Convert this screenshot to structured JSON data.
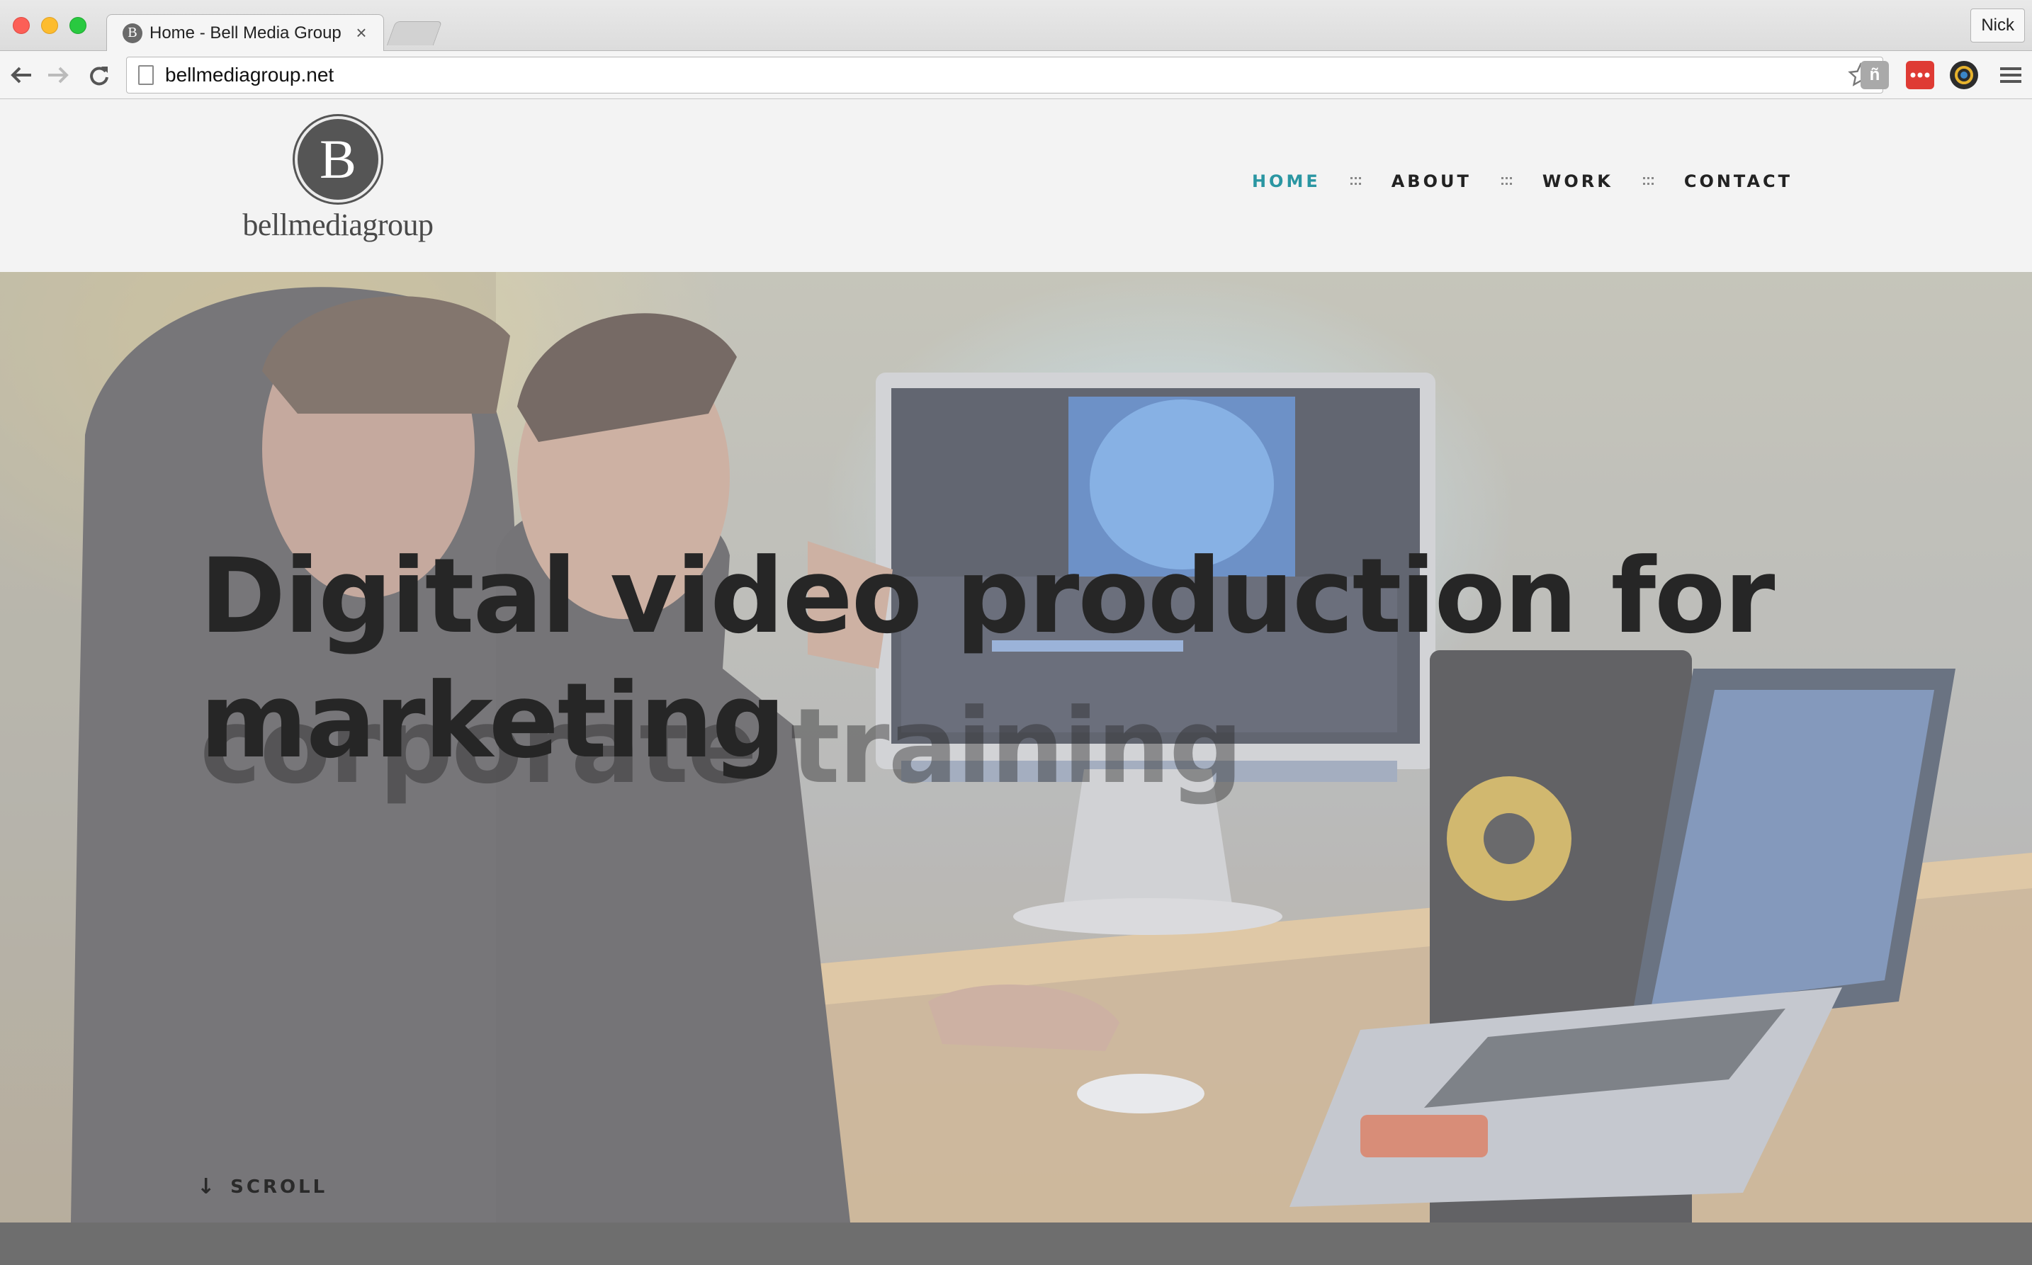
{
  "browser": {
    "tab_title": "Home - Bell Media Group",
    "tab_favicon_letter": "B",
    "tab_close_glyph": "×",
    "profile_name": "Nick",
    "url": "bellmediagroup.net",
    "icons": {
      "back": "back-arrow-icon",
      "forward": "forward-arrow-icon",
      "reload": "reload-icon",
      "page": "page-icon",
      "bookmark": "star-icon",
      "extensions": [
        "hiker-extension-icon",
        "lastpass-extension-icon",
        "camera-lens-extension-icon"
      ],
      "menu": "hamburger-menu-icon"
    },
    "extension_one_glyph": "ñ"
  },
  "site": {
    "logo_letter": "B",
    "logo_text": "bellmediagroup",
    "nav": [
      {
        "label": "HOME",
        "active": true
      },
      {
        "label": "ABOUT",
        "active": false
      },
      {
        "label": "WORK",
        "active": false
      },
      {
        "label": "CONTACT",
        "active": false
      }
    ],
    "accent_color": "#2a96a2"
  },
  "hero": {
    "headline_line1": "Digital video production for",
    "headline_word_current": "marketing",
    "headline_word_next": "corporate training",
    "scroll_label": "SCROLL",
    "scroll_glyph": "↓"
  }
}
